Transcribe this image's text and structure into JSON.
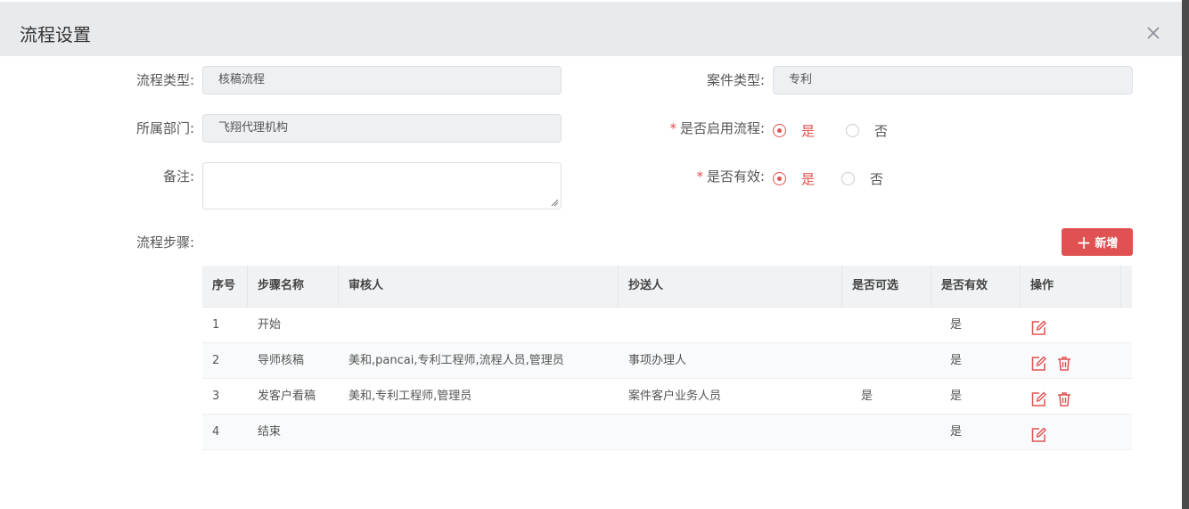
{
  "dialog": {
    "title": "流程设置"
  },
  "form": {
    "process_type_label": "流程类型:",
    "process_type_value": "核稿流程",
    "case_type_label": "案件类型:",
    "case_type_value": "专利",
    "department_label": "所属部门:",
    "department_value": "飞翔代理机构",
    "enable_label": "是否启用流程:",
    "enable_required": "*",
    "enable_yes": "是",
    "enable_no": "否",
    "valid_label": "是否有效:",
    "valid_required": "*",
    "valid_yes": "是",
    "valid_no": "否",
    "remark_label": "备注:",
    "steps_label": "流程步骤:"
  },
  "add_button": {
    "label": "新增"
  },
  "table": {
    "headers": [
      "序号",
      "步骤名称",
      "审核人",
      "抄送人",
      "是否可选",
      "是否有效",
      "操作"
    ],
    "rows": [
      {
        "no": "1",
        "name": "开始",
        "reviewer": "",
        "cc": "",
        "optional": "",
        "valid": "是"
      },
      {
        "no": "2",
        "name": "导师核稿",
        "reviewer": "美和,pancai,专利工程师,流程人员,管理员",
        "cc": "事项办理人",
        "optional": "",
        "valid": "是"
      },
      {
        "no": "3",
        "name": "发客户看稿",
        "reviewer": "美和,专利工程师,管理员",
        "cc": "案件客户业务人员",
        "optional": "是",
        "valid": "是"
      },
      {
        "no": "4",
        "name": "结束",
        "reviewer": "",
        "cc": "",
        "optional": "",
        "valid": "是"
      }
    ]
  },
  "colors": {
    "accent": "#e05252",
    "header_bg": "#e9eaec",
    "field_bg": "#eef0f3"
  },
  "icons": {
    "edit": "edit-icon",
    "delete": "trash-icon",
    "close": "close-icon",
    "add": "plus-icon"
  }
}
